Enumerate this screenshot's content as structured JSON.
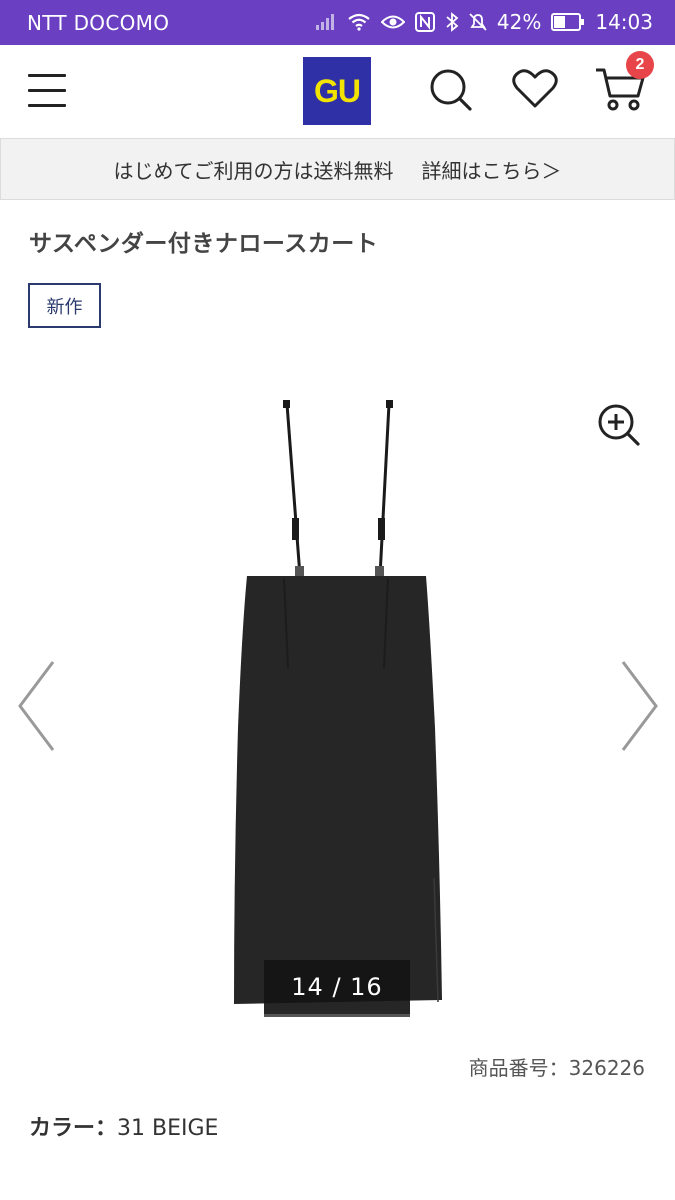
{
  "status_bar": {
    "carrier": "NTT DOCOMO",
    "battery": "42%",
    "time": "14:03"
  },
  "header": {
    "logo_text": "GU",
    "cart_count": "2",
    "icons": [
      "menu-icon",
      "search-icon",
      "heart-icon",
      "cart-icon"
    ]
  },
  "notice": {
    "text": "はじめてご利用の方は送料無料",
    "link": "詳細はこちら＞"
  },
  "product": {
    "title": "サスペンダー付きナロースカート",
    "tag": "新作",
    "image_counter": "14 / 16",
    "code": "商品番号：326226",
    "color_label": "カラー：",
    "color_value": "31 BEIGE"
  },
  "colors": {
    "status_bar_bg": "#6a3fc1",
    "logo_bg": "#2f2fa6",
    "logo_text": "#f2e400",
    "badge": "#e8454a",
    "tag_border": "#2a3a6e"
  }
}
